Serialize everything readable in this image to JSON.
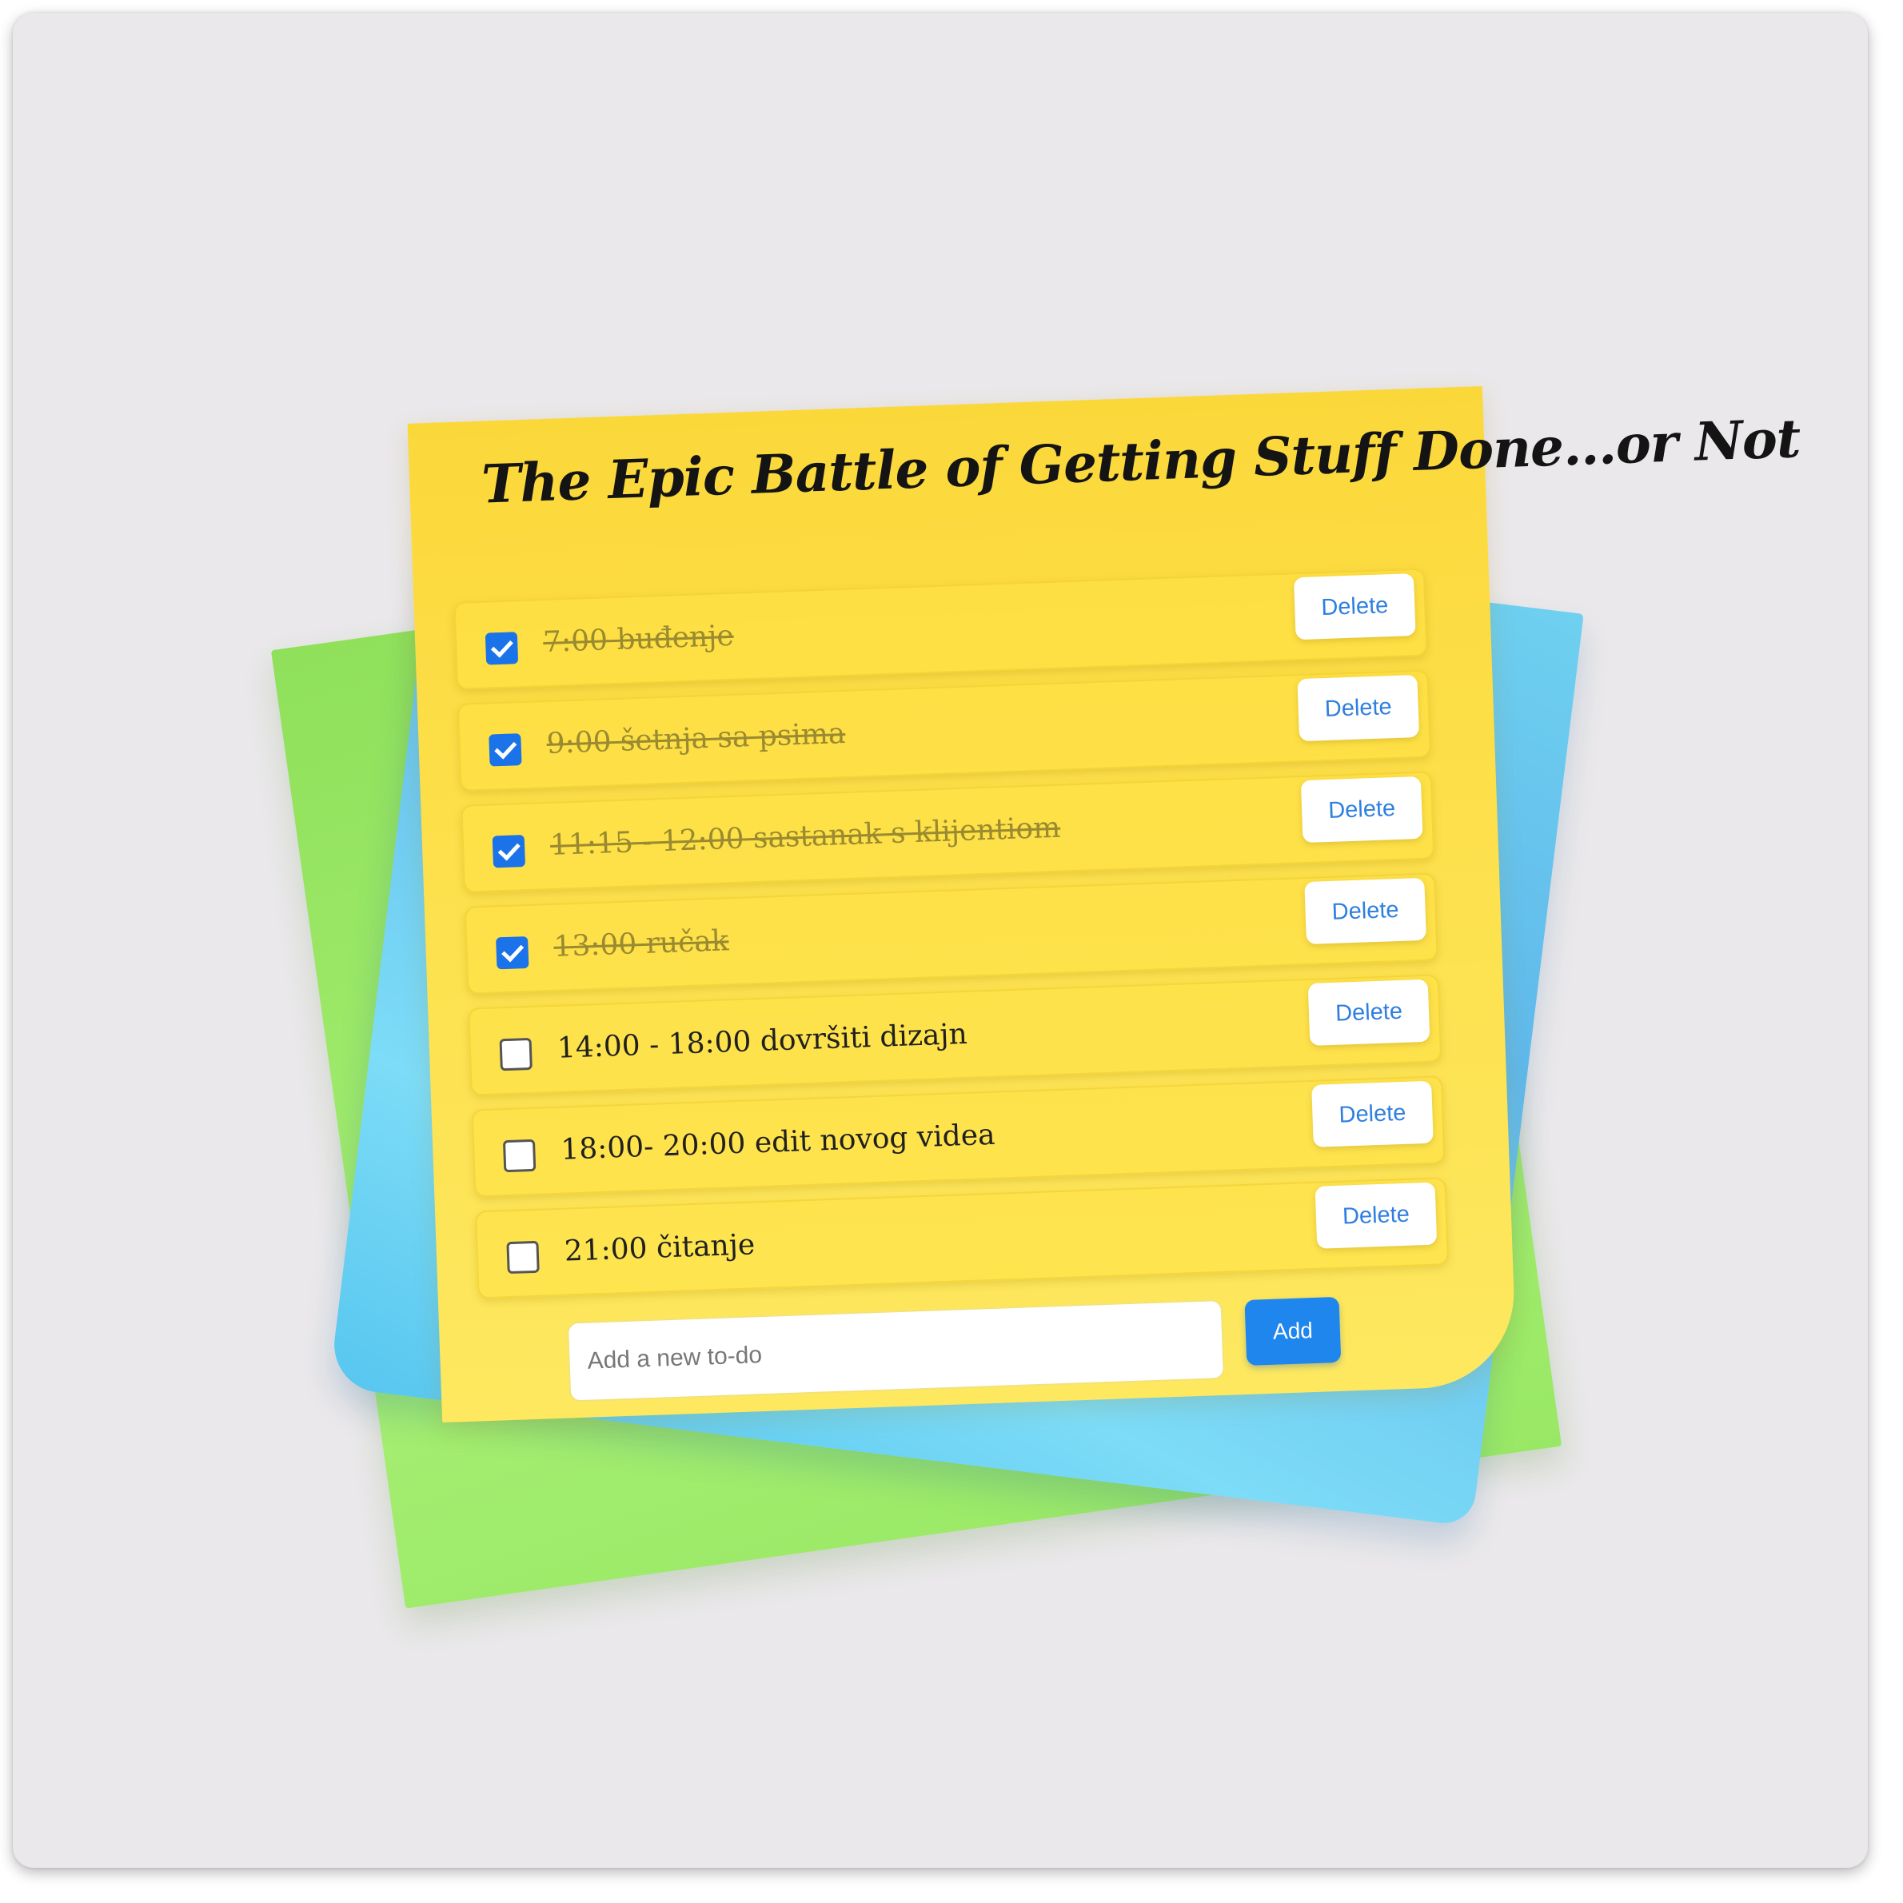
{
  "app": {
    "title": "The Epic Battle of Getting Stuff Done...or Not"
  },
  "todos": [
    {
      "text": "7:00 buđenje",
      "done": true,
      "delete_label": "Delete"
    },
    {
      "text": "9:00 šetnja sa psima",
      "done": true,
      "delete_label": "Delete"
    },
    {
      "text": "11:15 - 12:00 sastanak s klijentiom",
      "done": true,
      "delete_label": "Delete"
    },
    {
      "text": "13:00 ručak",
      "done": true,
      "delete_label": "Delete"
    },
    {
      "text": "14:00 - 18:00 dovršiti dizajn",
      "done": false,
      "delete_label": "Delete"
    },
    {
      "text": "18:00- 20:00 edit novog videa",
      "done": false,
      "delete_label": "Delete"
    },
    {
      "text": "21:00 čitanje",
      "done": false,
      "delete_label": "Delete"
    }
  ],
  "add_form": {
    "placeholder": "Add a new to-do",
    "value": "",
    "button_label": "Add"
  },
  "colors": {
    "background": "#eae8ea",
    "note_yellow": "#fde04c",
    "note_green": "#a6ef73",
    "note_blue": "#6fd0f0",
    "accent_blue": "#1f86ee",
    "delete_text": "#2f7fe0"
  },
  "icons": {
    "checked": "checkbox-checked-icon",
    "unchecked": "checkbox-unchecked-icon"
  }
}
